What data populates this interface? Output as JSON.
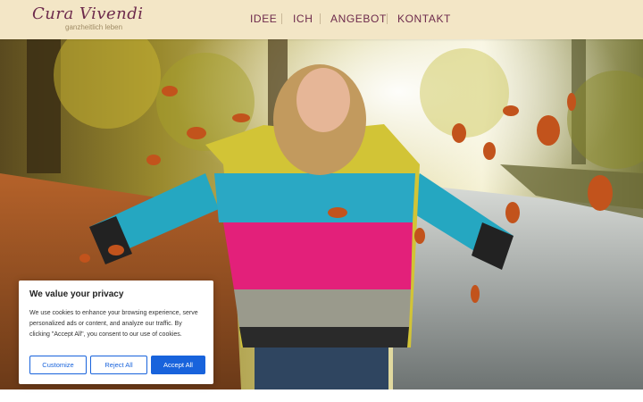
{
  "logo": {
    "title": "Cura Vivendi",
    "tagline": "ganzheitlich leben"
  },
  "nav": {
    "items": [
      {
        "label": "IDEE"
      },
      {
        "label": "ICH"
      },
      {
        "label": "ANGEBOT"
      },
      {
        "label": "KONTAKT"
      }
    ]
  },
  "hero": {
    "image": "woman-throwing-autumn-leaves-photo"
  },
  "cookie_banner": {
    "title": "We value your privacy",
    "text": "We use cookies to enhance your browsing experience, serve personalized ads or content, and analyze our traffic. By clicking \"Accept All\", you consent to our use of cookies.",
    "customize_label": "Customize",
    "reject_label": "Reject All",
    "accept_label": "Accept All"
  },
  "colors": {
    "header_bg": "#f3e6c6",
    "brand": "#6d2a4c",
    "accept_button": "#1863dc"
  }
}
